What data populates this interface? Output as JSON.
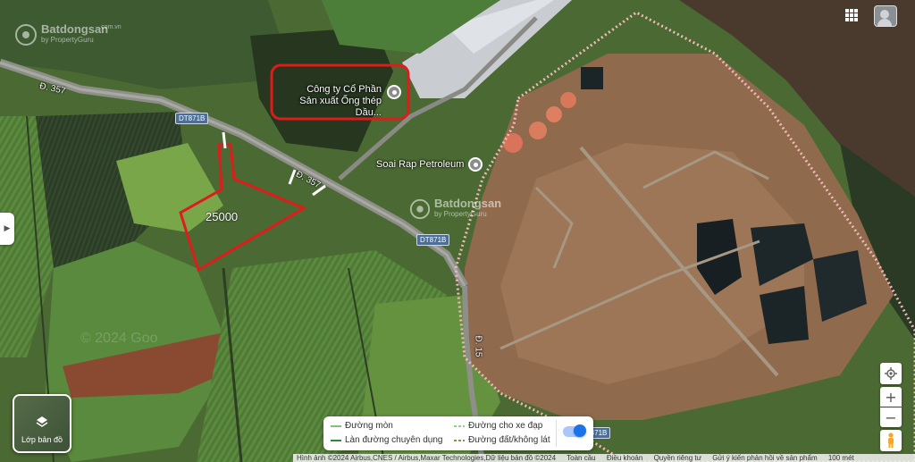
{
  "watermark": {
    "brand": "Batdongsan",
    "sub": "by PropertyGuru",
    "tld": ".com.vn",
    "year_text": "© 2024 Goo"
  },
  "road_labels": {
    "d357_west": "Đ. 357",
    "d357_mid": "Đ. 357",
    "d15": "Đ. 15",
    "dt871b_a": "DT871B",
    "dt871b_b": "DT871B",
    "dt871b_c": "DT871B"
  },
  "poi": {
    "company": "Công ty Cổ Phần Sản xuất Ống thép Dầu...",
    "company_line1": "Công ty Cổ Phần",
    "company_line2": "Sản xuất Ống thép Dầu...",
    "petroleum": "Soai Rap Petroleum"
  },
  "parcel": {
    "area_label": "25000"
  },
  "layers_button": {
    "label": "Lớp bản đồ"
  },
  "legend": {
    "items": [
      {
        "label": "Đường mòn",
        "color": "#7fc27f",
        "style": "solid"
      },
      {
        "label": "Làn đường chuyên dụng",
        "color": "#2e8b3a",
        "style": "solid"
      },
      {
        "label": "Đường cho xe đạp",
        "color": "#8fcf8f",
        "style": "dashed"
      },
      {
        "label": "Đường đất/không lát",
        "color": "#9c8a4a",
        "style": "dashed"
      }
    ],
    "toggle_on": true
  },
  "controls": {
    "zoom_in": "+",
    "zoom_out": "−"
  },
  "footer": {
    "items": [
      "Hình ảnh ©2024 Airbus,CNES / Airbus,Maxar Technologies,Dữ liệu bản đồ ©2024",
      "Toàn cầu",
      "Điều khoản",
      "Quyền riêng tư",
      "Gửi ý kiến phản hồi về sản phẩm",
      "100 mét"
    ]
  },
  "colors": {
    "parcel_outline": "#e01b1b",
    "highlight_box": "#e01b1b",
    "boundary_dots": "#f2b7b7",
    "toggle_blue": "#1a73e8"
  }
}
